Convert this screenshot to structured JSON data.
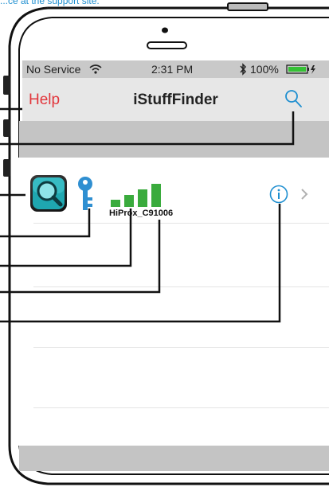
{
  "top_caption": "...ce at the support site.",
  "status_bar": {
    "carrier": "No Service",
    "time": "2:31 PM",
    "battery": "100%",
    "wifi_icon": "wifi-icon",
    "bluetooth_icon": "bluetooth-icon",
    "battery_icon": "battery-icon"
  },
  "nav": {
    "help_label": "Help",
    "title": "iStuffFinder",
    "search_icon": "search-icon"
  },
  "device_list": [
    {
      "name": "HiProx_C91006",
      "app_icon": "app-magnifier-icon",
      "key_icon": "key-icon",
      "signal_level": 1.0,
      "info_icon": "info-icon",
      "chevron_icon": "chevron-right-icon"
    }
  ],
  "colors": {
    "accent_red": "#e2353b",
    "accent_blue": "#1f8fd0",
    "signal_green": "#3aab3d",
    "key_blue": "#2f8fd1"
  }
}
